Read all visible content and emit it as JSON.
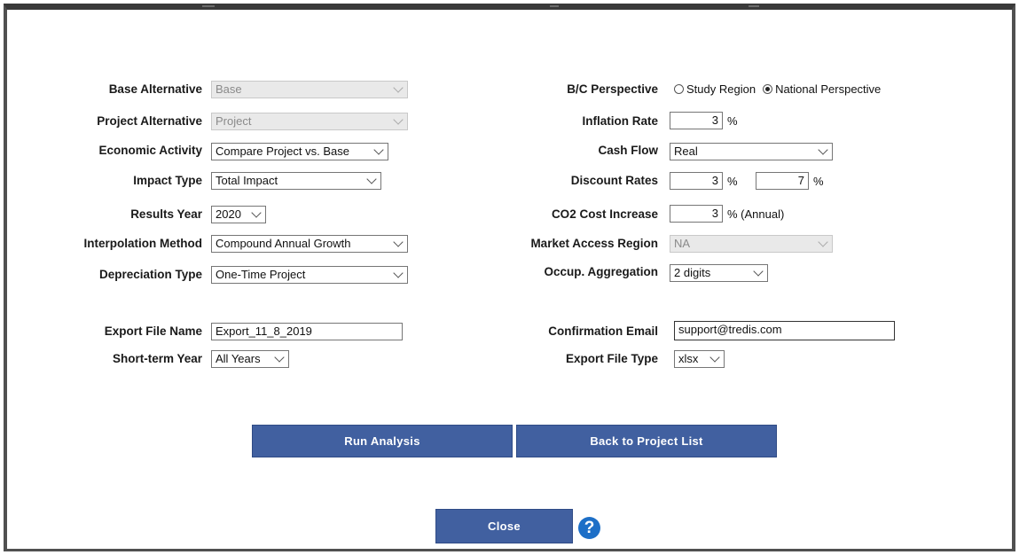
{
  "left_fields": {
    "base_alternative": {
      "label": "Base Alternative",
      "value": "Base"
    },
    "project_alternative": {
      "label": "Project Alternative",
      "value": "Project"
    },
    "economic_activity": {
      "label": "Economic Activity",
      "value": "Compare Project vs. Base"
    },
    "impact_type": {
      "label": "Impact Type",
      "value": "Total Impact"
    },
    "results_year": {
      "label": "Results Year",
      "value": "2020"
    },
    "interpolation_method": {
      "label": "Interpolation Method",
      "value": "Compound Annual Growth"
    },
    "depreciation_type": {
      "label": "Depreciation Type",
      "value": "One-Time Project"
    },
    "export_file_name": {
      "label": "Export File Name",
      "value": "Export_11_8_2019"
    },
    "short_term_year": {
      "label": "Short-term Year",
      "value": "All Years"
    }
  },
  "right_fields": {
    "bc_perspective": {
      "label": "B/C Perspective",
      "options": [
        "Study Region",
        "National Perspective"
      ],
      "selected": "National Perspective"
    },
    "inflation_rate": {
      "label": "Inflation Rate",
      "value": "3",
      "unit": "%"
    },
    "cash_flow": {
      "label": "Cash Flow",
      "value": "Real"
    },
    "discount_rates": {
      "label": "Discount Rates",
      "value_1": "3",
      "value_2": "7",
      "unit": "%"
    },
    "co2_cost_increase": {
      "label": "CO2 Cost Increase",
      "value": "3",
      "unit": "% (Annual)"
    },
    "market_access_region": {
      "label": "Market Access Region",
      "value": "NA"
    },
    "occup_aggregation": {
      "label": "Occup. Aggregation",
      "value": "2 digits"
    },
    "confirmation_email": {
      "label": "Confirmation Email",
      "value": "support@tredis.com"
    },
    "export_file_type": {
      "label": "Export File Type",
      "value": "xlsx"
    }
  },
  "buttons": {
    "run_analysis": "Run Analysis",
    "back_to_project_list": "Back to Project List",
    "close": "Close",
    "help": "?"
  },
  "colors": {
    "button_bg": "#4160a0",
    "help_icon": "#1d6fc7",
    "frame_border": "#505050"
  }
}
